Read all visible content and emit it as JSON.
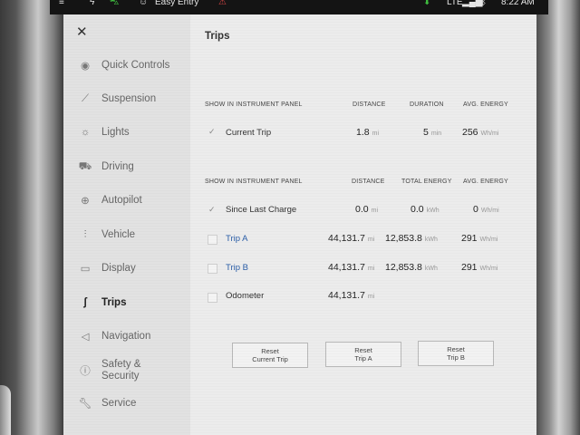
{
  "status_bar": {
    "left_text": "Easy Entry",
    "network": "LTE",
    "time": "8:22 AM"
  },
  "sidebar": {
    "close_icon": "close-icon",
    "items": [
      {
        "label": "Quick Controls",
        "icon": "quick-controls-icon"
      },
      {
        "label": "Suspension",
        "icon": "suspension-icon"
      },
      {
        "label": "Lights",
        "icon": "lights-icon"
      },
      {
        "label": "Driving",
        "icon": "car-icon"
      },
      {
        "label": "Autopilot",
        "icon": "steering-wheel-icon"
      },
      {
        "label": "Vehicle",
        "icon": "sliders-icon"
      },
      {
        "label": "Display",
        "icon": "display-icon"
      },
      {
        "label": "Trips",
        "icon": "trips-icon",
        "active": true
      },
      {
        "label": "Navigation",
        "icon": "navigation-icon"
      },
      {
        "label": "Safety &",
        "label2": "Security",
        "icon": "shield-icon"
      },
      {
        "label": "Service",
        "icon": "wrench-icon"
      }
    ]
  },
  "trips": {
    "title": "Trips",
    "section1": {
      "headers": [
        "SHOW IN INSTRUMENT PANEL",
        "DISTANCE",
        "DURATION",
        "AVG. ENERGY"
      ],
      "rows": [
        {
          "label": "Current Trip",
          "checked": true,
          "distance": "1.8",
          "distance_unit": "mi",
          "duration": "5",
          "duration_unit": "min",
          "energy": "256",
          "energy_unit": "Wh/mi"
        }
      ]
    },
    "section2": {
      "headers": [
        "SHOW IN INSTRUMENT PANEL",
        "DISTANCE",
        "TOTAL ENERGY",
        "AVG. ENERGY"
      ],
      "rows": [
        {
          "label": "Since Last Charge",
          "checked": true,
          "distance": "0.0",
          "distance_unit": "mi",
          "total": "0.0",
          "total_unit": "kWh",
          "energy": "0",
          "energy_unit": "Wh/mi"
        },
        {
          "label": "Trip A",
          "checked": false,
          "distance": "44,131.7",
          "distance_unit": "mi",
          "total": "12,853.8",
          "total_unit": "kWh",
          "energy": "291",
          "energy_unit": "Wh/mi"
        },
        {
          "label": "Trip B",
          "checked": false,
          "distance": "44,131.7",
          "distance_unit": "mi",
          "total": "12,853.8",
          "total_unit": "kWh",
          "energy": "291",
          "energy_unit": "Wh/mi"
        },
        {
          "label": "Odometer",
          "checked": false,
          "distance": "44,131.7",
          "distance_unit": "mi"
        }
      ]
    },
    "buttons": [
      {
        "line1": "Reset",
        "line2": "Current Trip"
      },
      {
        "line1": "Reset",
        "line2": "Trip A"
      },
      {
        "line1": "Reset",
        "line2": "Trip B"
      }
    ]
  }
}
